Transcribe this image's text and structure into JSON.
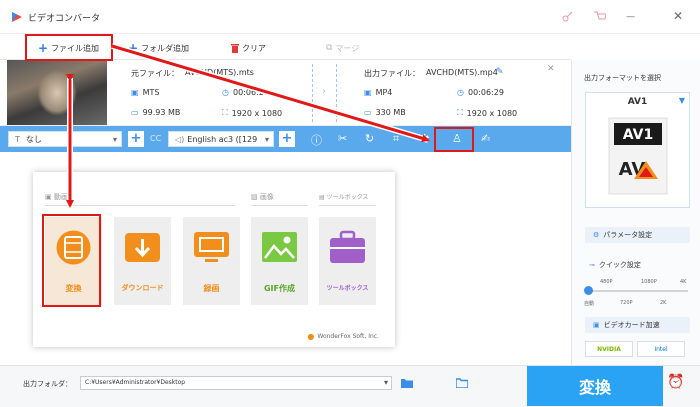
{
  "app": {
    "title": "ビデオコンバータ"
  },
  "toolbar": {
    "add_file": "ファイル追加",
    "add_folder": "フォルダ追加",
    "clear": "クリア",
    "merge": "マージ"
  },
  "file": {
    "source_label": "元ファイル：",
    "source_name": "AVCHD(MTS).mts",
    "source_format": "MTS",
    "source_duration": "00:06:29",
    "source_size": "99.93 MB",
    "source_resolution": "1920 x 1080",
    "output_label": "出力ファイル：",
    "output_name": "AVCHD(MTS).mp4",
    "output_format": "MP4",
    "output_duration": "00:06:29",
    "output_size": "330 MB",
    "output_resolution": "1920 x 1080"
  },
  "strip": {
    "subtitle": "なし",
    "audio": "English ac3 ([129"
  },
  "card": {
    "sections": {
      "video": "動画",
      "image": "画像",
      "toolbox": "ツールボックス"
    },
    "tiles": [
      "変換",
      "ダウンロード",
      "録画",
      "GIF作成",
      "ツールボックス"
    ],
    "brand": "WonderFox Soft, Inc."
  },
  "right": {
    "format_title": "出力フォーマットを選択",
    "format_name": "AV1",
    "param_button": "パラメータ設定",
    "quick_title": "クイック設定",
    "quick_labels": [
      "480P",
      "1080P",
      "4K",
      "自動",
      "720P",
      "2K"
    ],
    "gpu_title": "ビデオカード加速",
    "gpu_vendors": [
      "NVIDIA",
      "Intel"
    ]
  },
  "bottom": {
    "output_label": "出力フォルダ：",
    "output_path": "C:¥Users¥Administrator¥Desktop",
    "convert": "変換"
  },
  "colors": {
    "accent": "#2aa3f4",
    "strip": "#5aa9ec",
    "highlight": "#e01818",
    "tile_active": "#f28e1c"
  }
}
